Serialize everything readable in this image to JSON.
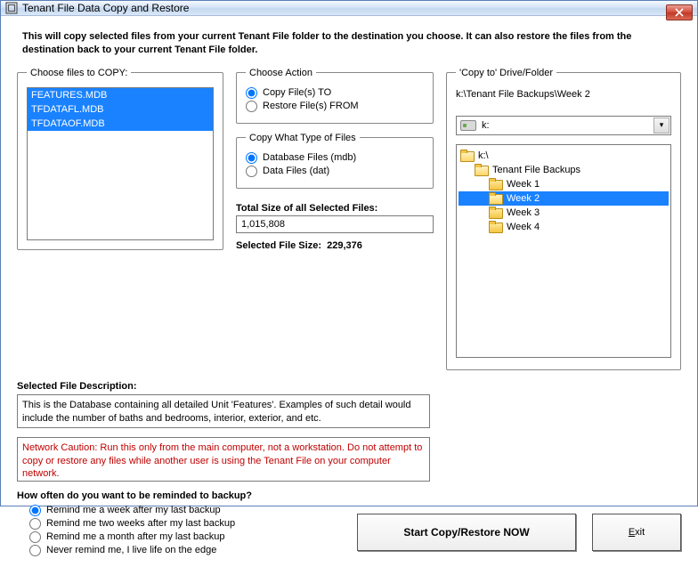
{
  "window": {
    "title": "Tenant File Data Copy and Restore"
  },
  "intro": "This will copy selected files from your current Tenant File folder to the destination you choose.  It can also restore the files from the destination back to your current Tenant File folder.",
  "files_to_copy": {
    "legend": "Choose files to COPY:",
    "items": [
      "FEATURES.MDB",
      "TFDATAFL.MDB",
      "TFDATAOF.MDB"
    ]
  },
  "choose_action": {
    "legend": "Choose Action",
    "copy_to": "Copy File(s) TO",
    "restore_from": "Restore File(s) FROM",
    "selected": "copy_to"
  },
  "file_type": {
    "legend": "Copy What Type of Files",
    "mdb": "Database Files (mdb)",
    "dat": "Data Files (dat)",
    "selected": "mdb"
  },
  "totals": {
    "label": "Total Size of all Selected Files:",
    "value": "1,015,808",
    "selected_label": "Selected File Size:",
    "selected_value": "229,376"
  },
  "description": {
    "label": "Selected File Description:",
    "text": "This is the Database containing all detailed Unit 'Features'.  Examples of such detail would include the number of baths and bedrooms, interior, exterior, and etc."
  },
  "caution": "Network Caution:  Run this only from the main computer, not a workstation. Do not attempt to copy or restore any files while another user is using the Tenant File on your computer network.",
  "remind": {
    "heading": "How often do you want to be reminded to backup?",
    "week": "Remind me a week after my last backup",
    "two_weeks": "Remind me two weeks after my last backup",
    "month": "Remind me a month after my last backup",
    "never": "Never remind me, I live life on the edge",
    "selected": "week"
  },
  "copy_to": {
    "legend": "'Copy to' Drive/Folder",
    "path": "k:\\Tenant File Backups\\Week 2",
    "drive": "k:",
    "tree": {
      "root": "k:\\",
      "folder1": "Tenant File Backups",
      "weeks": [
        "Week 1",
        "Week 2",
        "Week 3",
        "Week 4"
      ],
      "selected": "Week 2"
    }
  },
  "buttons": {
    "start": "Start Copy/Restore NOW",
    "exit": "Exit"
  }
}
